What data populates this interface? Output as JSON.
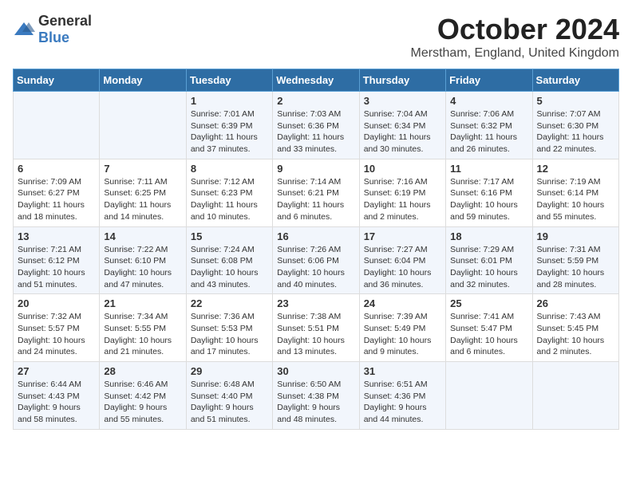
{
  "logo": {
    "text_general": "General",
    "text_blue": "Blue"
  },
  "title": "October 2024",
  "location": "Merstham, England, United Kingdom",
  "days_of_week": [
    "Sunday",
    "Monday",
    "Tuesday",
    "Wednesday",
    "Thursday",
    "Friday",
    "Saturday"
  ],
  "weeks": [
    [
      {
        "day": "",
        "text": ""
      },
      {
        "day": "",
        "text": ""
      },
      {
        "day": "1",
        "text": "Sunrise: 7:01 AM\nSunset: 6:39 PM\nDaylight: 11 hours and 37 minutes."
      },
      {
        "day": "2",
        "text": "Sunrise: 7:03 AM\nSunset: 6:36 PM\nDaylight: 11 hours and 33 minutes."
      },
      {
        "day": "3",
        "text": "Sunrise: 7:04 AM\nSunset: 6:34 PM\nDaylight: 11 hours and 30 minutes."
      },
      {
        "day": "4",
        "text": "Sunrise: 7:06 AM\nSunset: 6:32 PM\nDaylight: 11 hours and 26 minutes."
      },
      {
        "day": "5",
        "text": "Sunrise: 7:07 AM\nSunset: 6:30 PM\nDaylight: 11 hours and 22 minutes."
      }
    ],
    [
      {
        "day": "6",
        "text": "Sunrise: 7:09 AM\nSunset: 6:27 PM\nDaylight: 11 hours and 18 minutes."
      },
      {
        "day": "7",
        "text": "Sunrise: 7:11 AM\nSunset: 6:25 PM\nDaylight: 11 hours and 14 minutes."
      },
      {
        "day": "8",
        "text": "Sunrise: 7:12 AM\nSunset: 6:23 PM\nDaylight: 11 hours and 10 minutes."
      },
      {
        "day": "9",
        "text": "Sunrise: 7:14 AM\nSunset: 6:21 PM\nDaylight: 11 hours and 6 minutes."
      },
      {
        "day": "10",
        "text": "Sunrise: 7:16 AM\nSunset: 6:19 PM\nDaylight: 11 hours and 2 minutes."
      },
      {
        "day": "11",
        "text": "Sunrise: 7:17 AM\nSunset: 6:16 PM\nDaylight: 10 hours and 59 minutes."
      },
      {
        "day": "12",
        "text": "Sunrise: 7:19 AM\nSunset: 6:14 PM\nDaylight: 10 hours and 55 minutes."
      }
    ],
    [
      {
        "day": "13",
        "text": "Sunrise: 7:21 AM\nSunset: 6:12 PM\nDaylight: 10 hours and 51 minutes."
      },
      {
        "day": "14",
        "text": "Sunrise: 7:22 AM\nSunset: 6:10 PM\nDaylight: 10 hours and 47 minutes."
      },
      {
        "day": "15",
        "text": "Sunrise: 7:24 AM\nSunset: 6:08 PM\nDaylight: 10 hours and 43 minutes."
      },
      {
        "day": "16",
        "text": "Sunrise: 7:26 AM\nSunset: 6:06 PM\nDaylight: 10 hours and 40 minutes."
      },
      {
        "day": "17",
        "text": "Sunrise: 7:27 AM\nSunset: 6:04 PM\nDaylight: 10 hours and 36 minutes."
      },
      {
        "day": "18",
        "text": "Sunrise: 7:29 AM\nSunset: 6:01 PM\nDaylight: 10 hours and 32 minutes."
      },
      {
        "day": "19",
        "text": "Sunrise: 7:31 AM\nSunset: 5:59 PM\nDaylight: 10 hours and 28 minutes."
      }
    ],
    [
      {
        "day": "20",
        "text": "Sunrise: 7:32 AM\nSunset: 5:57 PM\nDaylight: 10 hours and 24 minutes."
      },
      {
        "day": "21",
        "text": "Sunrise: 7:34 AM\nSunset: 5:55 PM\nDaylight: 10 hours and 21 minutes."
      },
      {
        "day": "22",
        "text": "Sunrise: 7:36 AM\nSunset: 5:53 PM\nDaylight: 10 hours and 17 minutes."
      },
      {
        "day": "23",
        "text": "Sunrise: 7:38 AM\nSunset: 5:51 PM\nDaylight: 10 hours and 13 minutes."
      },
      {
        "day": "24",
        "text": "Sunrise: 7:39 AM\nSunset: 5:49 PM\nDaylight: 10 hours and 9 minutes."
      },
      {
        "day": "25",
        "text": "Sunrise: 7:41 AM\nSunset: 5:47 PM\nDaylight: 10 hours and 6 minutes."
      },
      {
        "day": "26",
        "text": "Sunrise: 7:43 AM\nSunset: 5:45 PM\nDaylight: 10 hours and 2 minutes."
      }
    ],
    [
      {
        "day": "27",
        "text": "Sunrise: 6:44 AM\nSunset: 4:43 PM\nDaylight: 9 hours and 58 minutes."
      },
      {
        "day": "28",
        "text": "Sunrise: 6:46 AM\nSunset: 4:42 PM\nDaylight: 9 hours and 55 minutes."
      },
      {
        "day": "29",
        "text": "Sunrise: 6:48 AM\nSunset: 4:40 PM\nDaylight: 9 hours and 51 minutes."
      },
      {
        "day": "30",
        "text": "Sunrise: 6:50 AM\nSunset: 4:38 PM\nDaylight: 9 hours and 48 minutes."
      },
      {
        "day": "31",
        "text": "Sunrise: 6:51 AM\nSunset: 4:36 PM\nDaylight: 9 hours and 44 minutes."
      },
      {
        "day": "",
        "text": ""
      },
      {
        "day": "",
        "text": ""
      }
    ]
  ]
}
